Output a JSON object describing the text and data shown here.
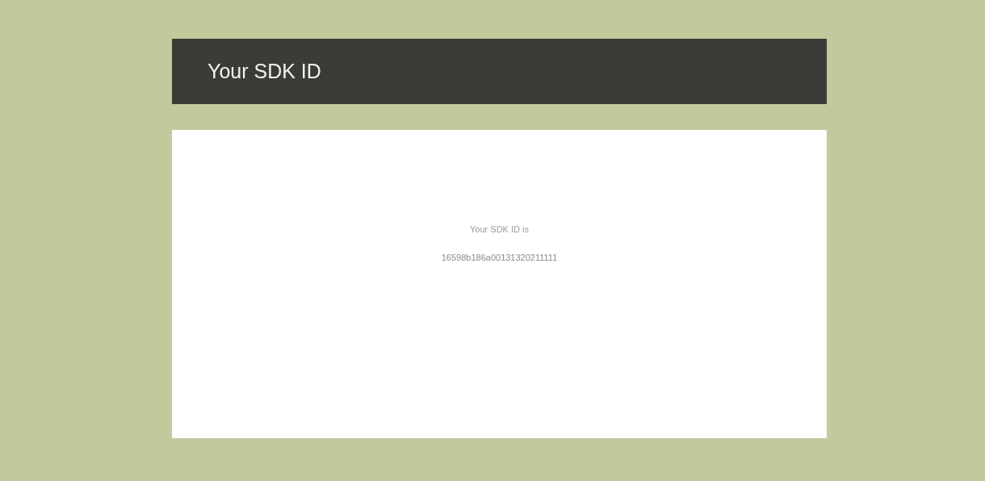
{
  "header": {
    "title": "Your SDK ID"
  },
  "card": {
    "label": "Your SDK ID is",
    "sdk_id": "16598b186a00131320211111"
  }
}
